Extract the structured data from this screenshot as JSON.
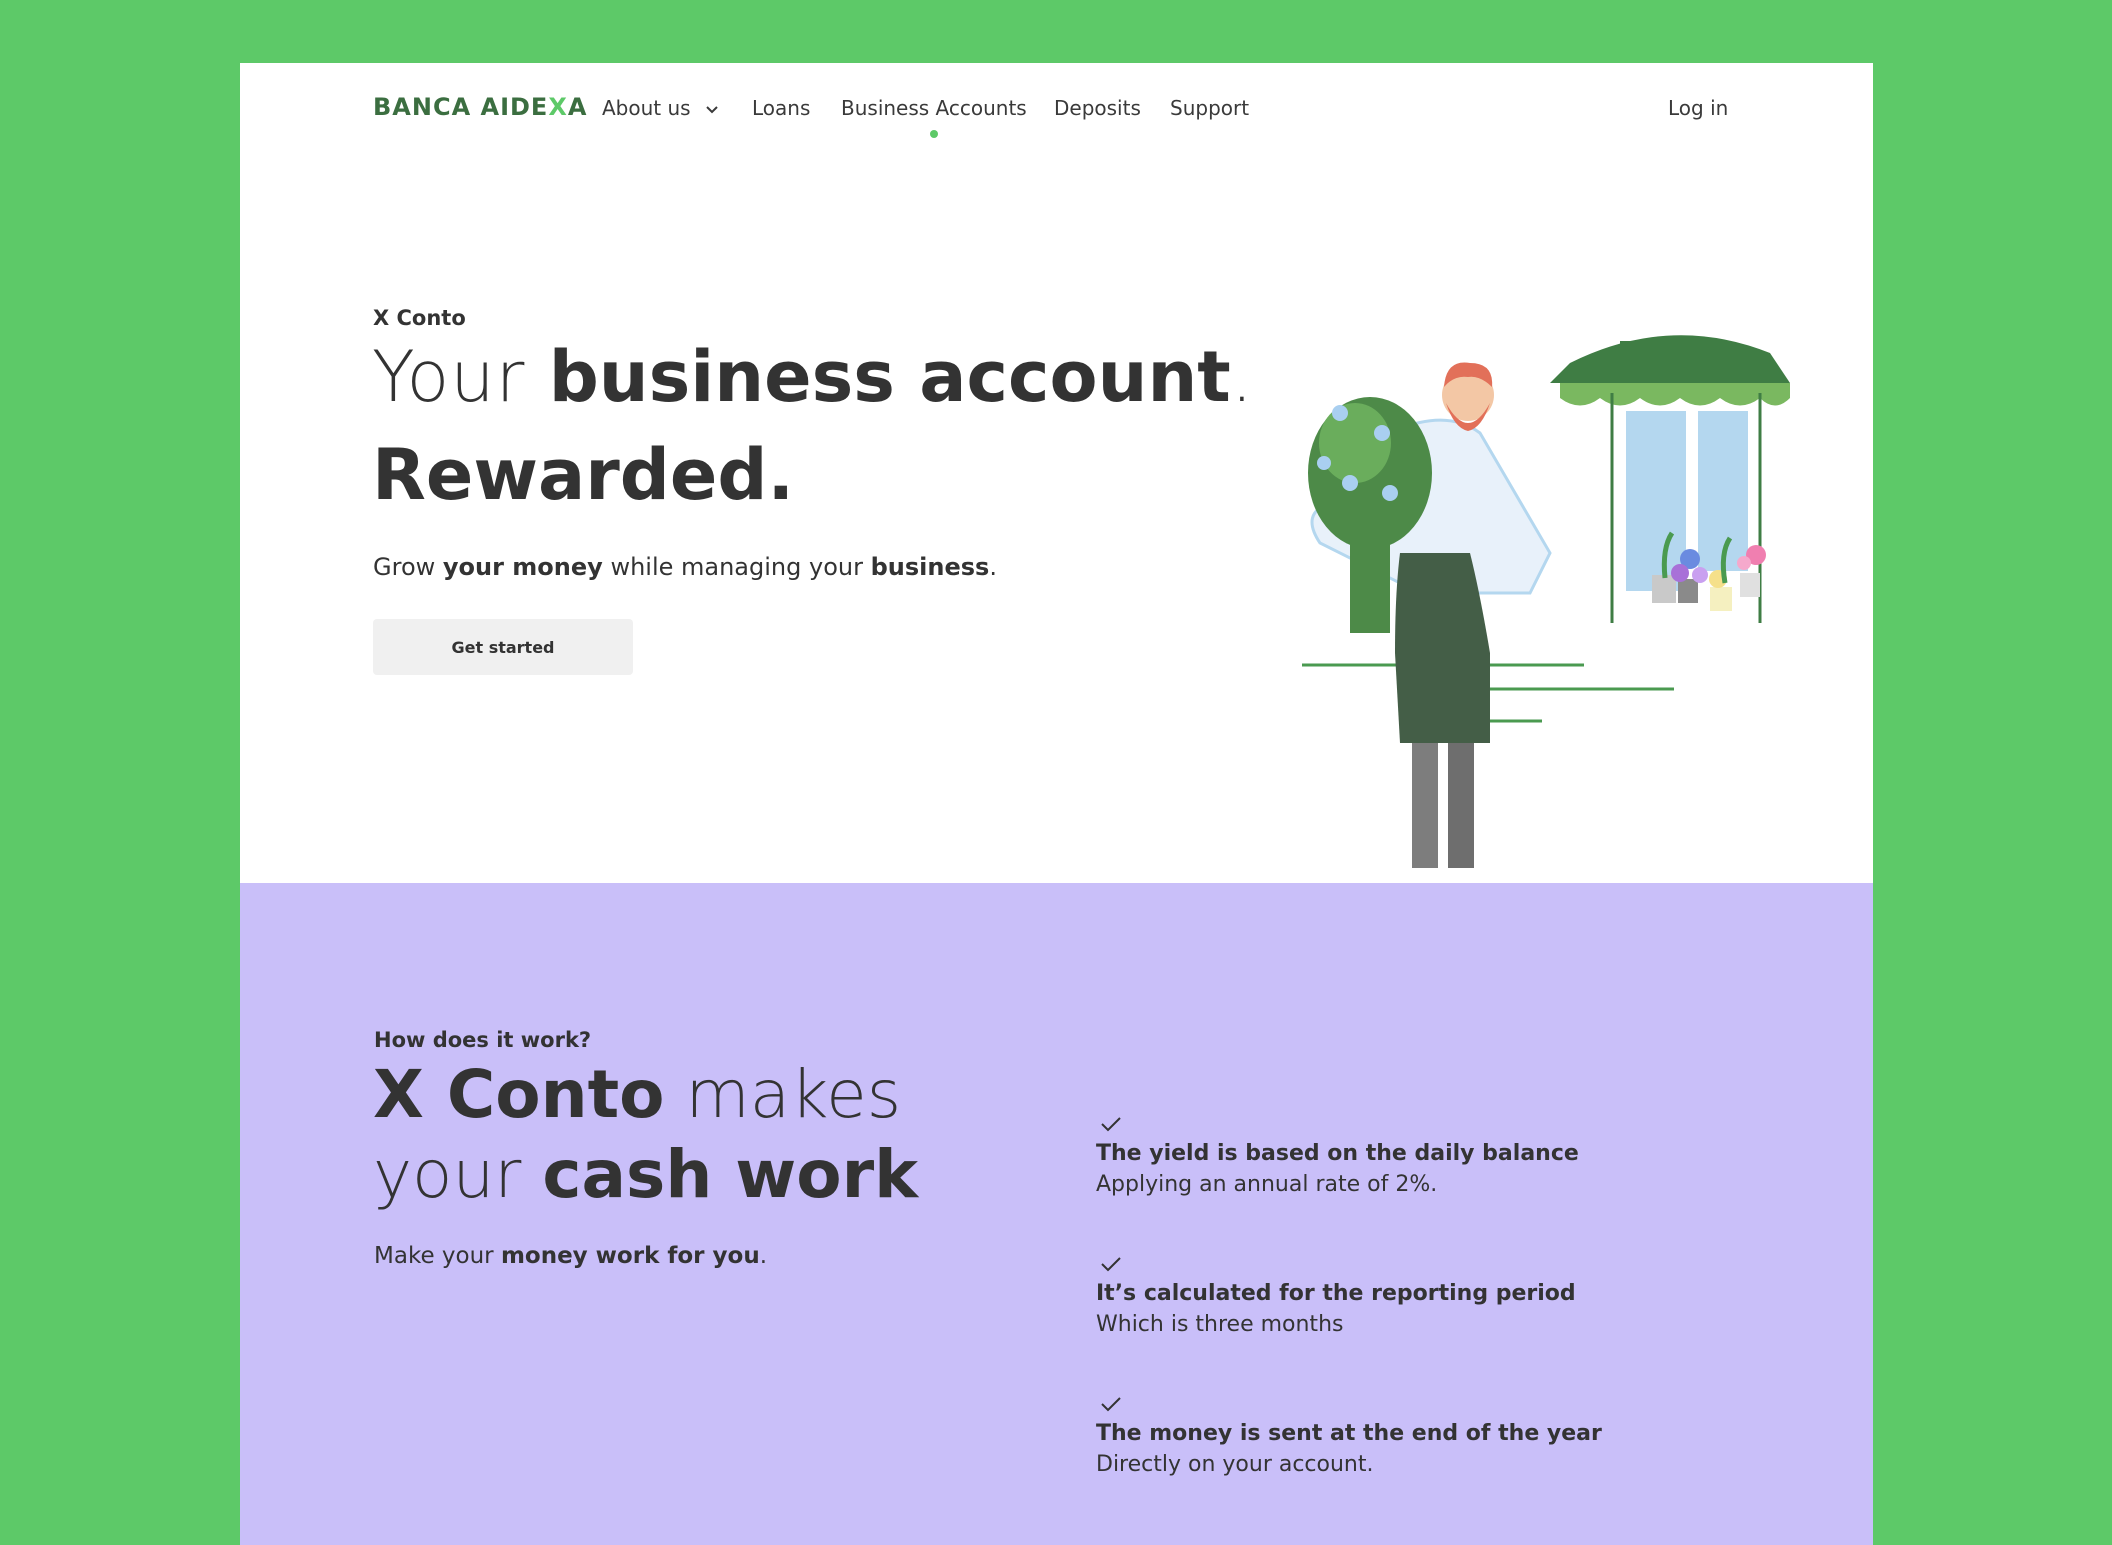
{
  "brand": {
    "logo_prefix": "BANCA AIDE",
    "logo_x": "X",
    "logo_suffix": "A"
  },
  "nav": {
    "about": "About us",
    "loans": "Loans",
    "business": "Business Accounts",
    "deposits": "Deposits",
    "support": "Support",
    "login": "Log in",
    "active": "Business Accounts"
  },
  "hero": {
    "eyebrow": "X Conto",
    "title_line1_thin": "Your ",
    "title_line1_bold": "business account",
    "title_line1_end": ".",
    "title_line2": "Rewarded.",
    "subtitle_1": "Grow ",
    "subtitle_2": "your money",
    "subtitle_3": " while managing your ",
    "subtitle_4": "business",
    "subtitle_5": ".",
    "cta": "Get started"
  },
  "how": {
    "eyebrow": "How does it work?",
    "title_l1_bold": "X Conto",
    "title_l1_thin": " makes",
    "title_l2_thin": "your ",
    "title_l2_bold": "cash work",
    "subtitle_1": "Make your ",
    "subtitle_2": "money work for you",
    "subtitle_3": ".",
    "features": [
      {
        "title": "The yield is based on the daily balance",
        "desc": "Applying an annual rate of 2%."
      },
      {
        "title": "It’s calculated for the reporting period",
        "desc": "Which is three months"
      },
      {
        "title": "The money is sent at the end of the year",
        "desc": "Directly on your account."
      }
    ]
  },
  "colors": {
    "background": "#5dc968",
    "accent": "#5dc968",
    "brand_green": "#3b6e40",
    "section_purple": "#c9bff9",
    "text": "#333333",
    "button_bg": "#f0f0f0"
  },
  "icons": [
    "chevron-down-icon",
    "check-icon"
  ]
}
